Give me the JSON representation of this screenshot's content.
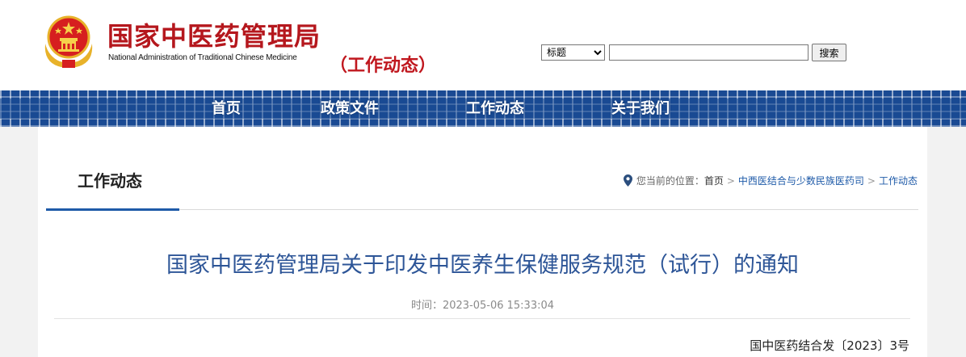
{
  "header": {
    "org_name_cn": "国家中医药管理局",
    "org_name_en": "National Administration of Traditional Chinese Medicine",
    "section_tag": "（工作动态）",
    "search": {
      "select_value": "标题",
      "options": [
        "标题"
      ],
      "input_value": "",
      "button_label": "搜索"
    },
    "colors": {
      "brand_red": "#b5171d",
      "emblem_gold": "#e8b22a"
    }
  },
  "nav": {
    "items": [
      {
        "label": "首页"
      },
      {
        "label": "政策文件"
      },
      {
        "label": "工作动态"
      },
      {
        "label": "关于我们"
      }
    ],
    "colors": {
      "bar_blue": "#1a4a93"
    }
  },
  "page": {
    "section_title": "工作动态",
    "breadcrumb": {
      "prefix": "您当前的位置：",
      "items": [
        "首页",
        "中西医结合与少数民族医药司",
        "工作动态"
      ],
      "separator": ">"
    }
  },
  "article": {
    "title": "国家中医药管理局关于印发中医养生保健服务规范（试行）的通知",
    "time": "时间：2023-05-06 15:33:04",
    "doc_number": "国中医药结合发〔2023〕3号",
    "colors": {
      "title_blue": "#2d5597",
      "accent_blue": "#1e5aa8"
    }
  }
}
